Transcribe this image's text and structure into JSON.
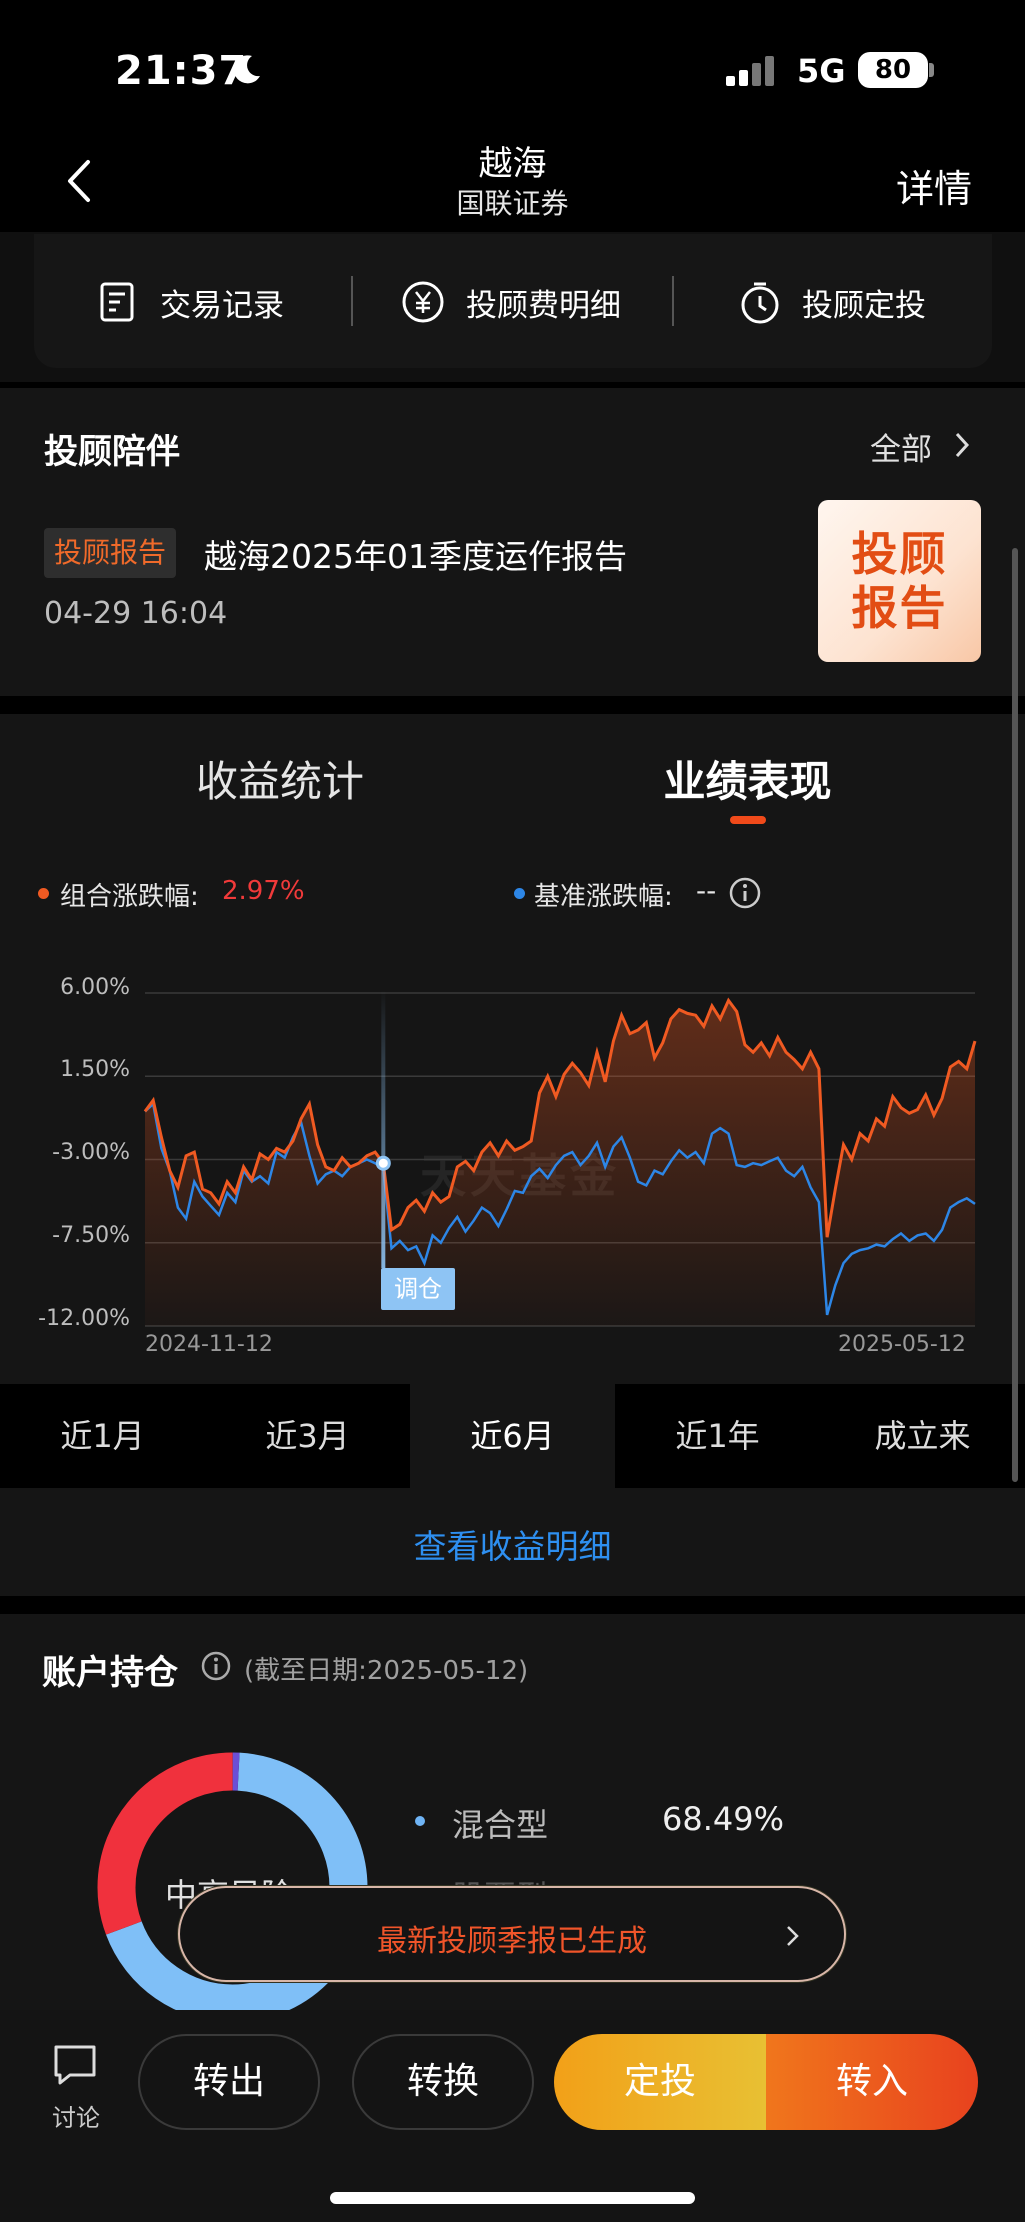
{
  "status": {
    "time": "21:37",
    "network": "5G",
    "battery": "80"
  },
  "nav": {
    "title": "越海",
    "subtitle": "国联证券",
    "detail": "详情"
  },
  "actions": [
    {
      "label": "交易记录",
      "icon": "receipt-icon"
    },
    {
      "label": "投顾费明细",
      "icon": "yen-icon"
    },
    {
      "label": "投顾定投",
      "icon": "timer-icon"
    }
  ],
  "advisor": {
    "title": "投顾陪伴",
    "all": "全部",
    "report_tag": "投顾报告",
    "report_title": "越海2025年01季度运作报告",
    "report_time": "04-29 16:04",
    "thumb_line1": "投顾",
    "thumb_line2": "报告"
  },
  "perf": {
    "tab_stats": "收益统计",
    "tab_perf": "业绩表现",
    "legend_a_label": "组合涨跌幅:",
    "legend_a_value": "2.97%",
    "legend_b_label": "基准涨跌幅:",
    "legend_b_value": "--",
    "watermark": "天天基金",
    "rebalance": "调仓",
    "periods": [
      "近1月",
      "近3月",
      "近6月",
      "近1年",
      "成立来"
    ],
    "active_period": 2,
    "detail_link": "查看收益明细"
  },
  "chart_data": {
    "type": "line",
    "x_start": "2024-11-12",
    "x_end": "2025-05-12",
    "yticks": [
      "6.00%",
      "1.50%",
      "-3.00%",
      "-7.50%",
      "-12.00%"
    ],
    "ylim": [
      -12,
      6
    ],
    "series": [
      {
        "name": "组合涨跌幅",
        "color": "#f05a22",
        "values": [
          -0.4,
          0.2,
          -1.8,
          -3.6,
          -4.5,
          -2.8,
          -2.6,
          -4.6,
          -4.8,
          -5.4,
          -4.2,
          -4.8,
          -3.4,
          -4.1,
          -2.7,
          -3.0,
          -2.4,
          -2.6,
          -2.0,
          -0.8,
          0.0,
          -2.2,
          -3.4,
          -3.6,
          -2.9,
          -3.4,
          -3.2,
          -2.8,
          -2.6,
          -3.2,
          -6.8,
          -6.5,
          -5.6,
          -5.2,
          -5.8,
          -4.8,
          -5.3,
          -5.0,
          -3.4,
          -3.1,
          -3.6,
          -2.6,
          -2.1,
          -2.8,
          -2.0,
          -2.5,
          -2.3,
          -2.0,
          0.6,
          1.5,
          0.4,
          1.6,
          2.2,
          1.7,
          1.0,
          2.8,
          1.2,
          3.4,
          4.8,
          3.8,
          4.0,
          4.4,
          2.5,
          3.3,
          4.6,
          5.1,
          4.9,
          4.8,
          4.2,
          5.3,
          4.6,
          5.6,
          5.0,
          3.2,
          2.8,
          3.3,
          2.6,
          3.6,
          2.8,
          2.4,
          1.9,
          2.8,
          1.9,
          -7.2,
          -4.6,
          -2.2,
          -3.0,
          -1.6,
          -2.0,
          -0.8,
          -1.2,
          0.4,
          -0.2,
          -0.5,
          -0.3,
          0.5,
          -0.6,
          0.3,
          2.0,
          2.3,
          1.9,
          3.4
        ]
      },
      {
        "name": "基准涨跌幅",
        "color": "#2d86e6",
        "values": [
          -0.4,
          0.0,
          -2.4,
          -3.6,
          -5.6,
          -6.2,
          -4.2,
          -5.0,
          -5.5,
          -6.0,
          -4.8,
          -5.3,
          -3.6,
          -4.2,
          -3.9,
          -4.3,
          -2.6,
          -2.9,
          -1.8,
          -1.0,
          -2.8,
          -4.3,
          -3.8,
          -3.6,
          -3.9,
          -3.4,
          -3.2,
          -3.0,
          -3.2,
          -3.5,
          -7.8,
          -7.4,
          -7.9,
          -7.7,
          -8.6,
          -7.1,
          -7.5,
          -6.7,
          -6.1,
          -6.9,
          -6.3,
          -5.6,
          -5.9,
          -6.6,
          -5.7,
          -4.7,
          -4.8,
          -3.9,
          -3.5,
          -4.0,
          -3.3,
          -2.8,
          -2.6,
          -3.3,
          -2.8,
          -2.1,
          -3.4,
          -2.3,
          -1.8,
          -2.9,
          -4.2,
          -4.4,
          -3.6,
          -3.8,
          -3.1,
          -2.5,
          -2.9,
          -2.6,
          -3.2,
          -1.6,
          -1.3,
          -1.6,
          -3.3,
          -3.4,
          -3.2,
          -3.3,
          -3.1,
          -2.9,
          -3.6,
          -3.9,
          -3.4,
          -4.5,
          -5.3,
          -11.4,
          -9.8,
          -8.6,
          -8.1,
          -7.9,
          -7.8,
          -7.6,
          -7.7,
          -7.3,
          -7.0,
          -7.4,
          -7.1,
          -7.0,
          -7.4,
          -6.8,
          -5.6,
          -5.3,
          -5.1,
          -5.4
        ]
      }
    ]
  },
  "holdings": {
    "title": "账户持仓",
    "date": "(截至日期:2025-05-12)",
    "donut_label": "中高风险",
    "type1": "混合型",
    "pct1": "68.49%",
    "type2": "股票型",
    "colors": {
      "blue": "#7fbff7",
      "red": "#f0313d",
      "purple": "#6b4fd6"
    },
    "shares": {
      "blue": 68.49,
      "red": 30.7,
      "purple": 0.81
    }
  },
  "toast": {
    "text": "最新投顾季报已生成"
  },
  "bottom": {
    "discuss": "讨论",
    "out": "转出",
    "switch": "转换",
    "plan": "定投",
    "in": "转入"
  }
}
